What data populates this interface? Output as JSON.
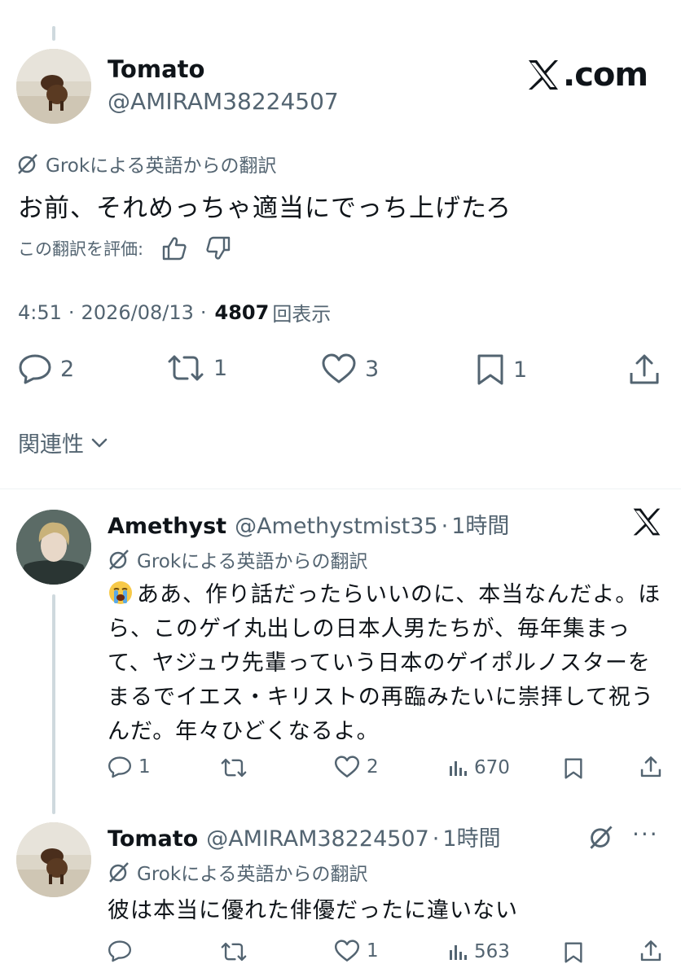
{
  "brand": {
    "logo_icon": "x-logo-icon",
    "site": ".com"
  },
  "main_tweet": {
    "author_name": "Tomato",
    "author_handle": "@AMIRAM38224507",
    "translation_label": "Grokによる英語からの翻訳",
    "text": "お前、それめっちゃ適当にでっち上げたろ",
    "rate_translation_label": "この翻訳を評価:",
    "time": "4:51",
    "date": "2026/08/13",
    "separator": "·",
    "views": "4807",
    "views_label": "回表示",
    "actions": {
      "replies": "2",
      "reposts": "1",
      "likes": "3",
      "bookmarks": "1"
    }
  },
  "relevance_label": "関連性",
  "replies": [
    {
      "author_name": "Amethyst",
      "author_handle": "@Amethystmist35",
      "separator": "·",
      "time": "1時間",
      "translation_label": "Grokによる英語からの翻訳",
      "emoji": "😭",
      "text": "ああ、作り話だったらいいのに、本当なんだよ。ほら、このゲイ丸出しの日本人男たちが、毎年集まって、ヤジュウ先輩っていう日本のゲイポルノスターをまるでイエス・キリストの再臨みたいに崇拝して祝うんだ。年々ひどくなるよ。",
      "actions": {
        "replies": "1",
        "reposts": "",
        "likes": "2",
        "views": "670"
      }
    },
    {
      "author_name": "Tomato",
      "author_handle": "@AMIRAM38224507",
      "separator": "·",
      "time": "1時間",
      "more": "···",
      "translation_label": "Grokによる英語からの翻訳",
      "text": "彼は本当に優れた俳優だったに違いない",
      "actions": {
        "replies": "",
        "reposts": "",
        "likes": "1",
        "views": "563"
      }
    }
  ],
  "colors": {
    "text": "#0f1419",
    "muted": "#536471",
    "thread_line": "#cfd9de"
  }
}
